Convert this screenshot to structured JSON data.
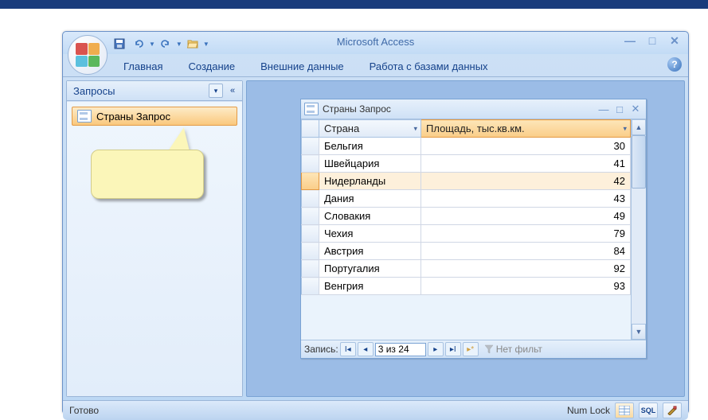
{
  "app": {
    "title": "Microsoft Access"
  },
  "ribbon": {
    "tabs": [
      "Главная",
      "Создание",
      "Внешние данные",
      "Работа с базами данных"
    ]
  },
  "navpane": {
    "header": "Запросы",
    "item_label": "Страны Запрос"
  },
  "childwin": {
    "title": "Страны Запрос"
  },
  "datasheet": {
    "col1_header": "Страна",
    "col2_header": "Площадь, тыс.кв.км.",
    "rows": [
      {
        "c1": "Бельгия",
        "c2": "30"
      },
      {
        "c1": "Швейцария",
        "c2": "41"
      },
      {
        "c1": "Нидерланды",
        "c2": "42"
      },
      {
        "c1": "Дания",
        "c2": "43"
      },
      {
        "c1": "Словакия",
        "c2": "49"
      },
      {
        "c1": "Чехия",
        "c2": "79"
      },
      {
        "c1": "Австрия",
        "c2": "84"
      },
      {
        "c1": "Португалия",
        "c2": "92"
      },
      {
        "c1": "Венгрия",
        "c2": "93"
      }
    ],
    "selected_index": 2
  },
  "recordnav": {
    "label": "Запись:",
    "position_text": "3 из 24",
    "filter_text": "Нет фильт"
  },
  "statusbar": {
    "left": "Готово",
    "numlock": "Num Lock",
    "sql_label": "SQL"
  }
}
